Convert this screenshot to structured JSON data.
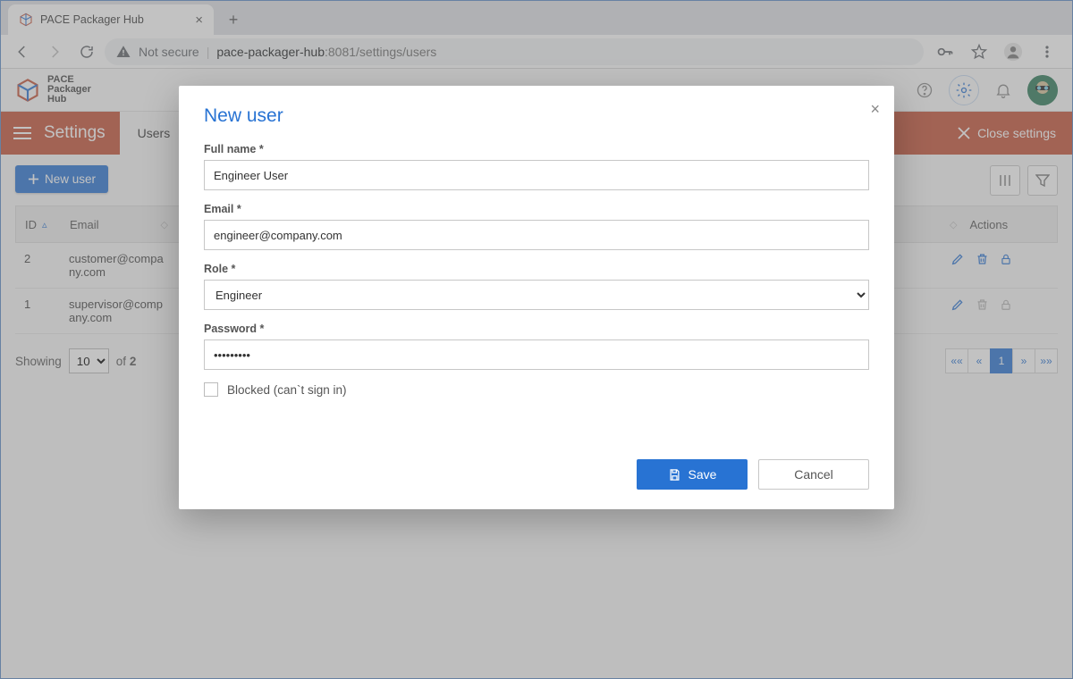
{
  "browser": {
    "tab_title": "PACE Packager Hub",
    "not_secure_label": "Not secure",
    "url_domain": "pace-packager-hub",
    "url_port_path": ":8081/settings/users"
  },
  "app": {
    "logo_line1": "PACE",
    "logo_line2": "Packager",
    "logo_line3": "Hub"
  },
  "settings_bar": {
    "title": "Settings",
    "tab_label": "Users",
    "close_label": "Close settings"
  },
  "toolbar": {
    "new_user_label": "New user"
  },
  "grid": {
    "headers": {
      "id": "ID",
      "email": "Email",
      "actions": "Actions"
    },
    "rows": [
      {
        "id": "2",
        "email": "customer@company.com"
      },
      {
        "id": "1",
        "email": "supervisor@company.com"
      }
    ]
  },
  "footer": {
    "showing": "Showing",
    "of": "of",
    "total": "2",
    "page_size": "10",
    "pager_current": "1"
  },
  "modal": {
    "title": "New user",
    "labels": {
      "full_name": "Full name *",
      "email": "Email *",
      "role": "Role *",
      "password": "Password *",
      "blocked": "Blocked (can`t sign in)"
    },
    "values": {
      "full_name": "Engineer User",
      "email": "engineer@company.com",
      "role": "Engineer",
      "password": "•••••••••"
    },
    "buttons": {
      "save": "Save",
      "cancel": "Cancel"
    }
  }
}
